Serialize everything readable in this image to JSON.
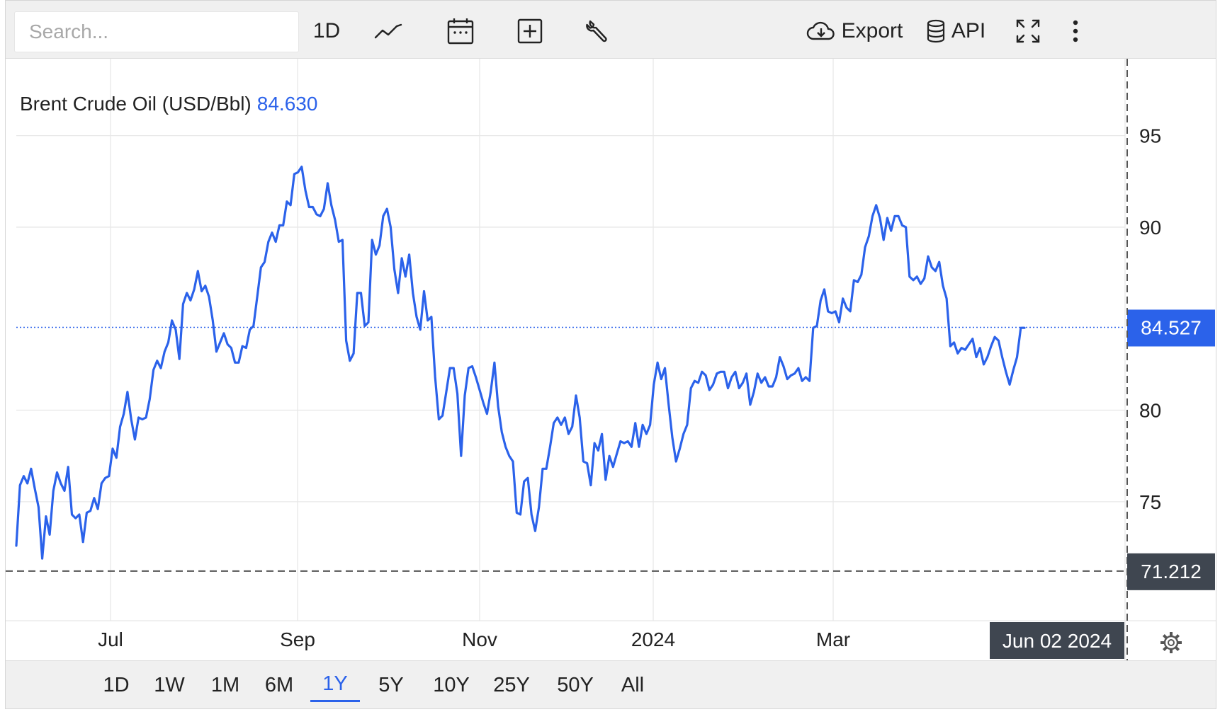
{
  "toolbar": {
    "search_placeholder": "Search...",
    "interval_label": "1D",
    "export_label": "Export",
    "api_label": "API"
  },
  "icons": {
    "chart_type": "line-chart-icon",
    "calendar": "calendar-icon",
    "add": "plus-square-icon",
    "tools": "wrench-icon",
    "export": "cloud-download-icon",
    "api": "database-icon",
    "fullscreen": "expand-icon",
    "more": "vertical-dots-icon",
    "settings": "gear-icon"
  },
  "colors": {
    "line": "#2b62ea",
    "price_badge": "#2b62ea",
    "crosshair_badge": "#3f4650",
    "grid": "#e8e8e8"
  },
  "chart_data": {
    "type": "line",
    "title": "Brent Crude Oil (USD/Bbl)",
    "title_value": "84.630",
    "x_tick_labels": [
      "Jul",
      "Sep",
      "Nov",
      "2024",
      "Mar"
    ],
    "y_tick_labels": [
      "95",
      "90",
      "80",
      "75"
    ],
    "ylim": [
      68.5,
      99.2
    ],
    "grid": true,
    "last_price_label": "84.527",
    "last_price": 84.527,
    "crosshair_price_label": "71.212",
    "crosshair_price": 71.212,
    "crosshair_date_label": "Jun 02 2024",
    "series": [
      {
        "values": [
          72.6,
          75.9,
          76.4,
          76.0,
          76.8,
          75.7,
          74.7,
          71.9,
          74.2,
          73.2,
          75.6,
          76.6,
          76.0,
          75.6,
          76.9,
          74.3,
          74.1,
          74.3,
          72.8,
          74.4,
          74.5,
          75.2,
          74.6,
          76.0,
          76.3,
          76.4,
          77.9,
          77.4,
          79.1,
          79.8,
          81.0,
          79.5,
          78.4,
          79.6,
          79.5,
          79.6,
          80.6,
          82.2,
          82.7,
          82.3,
          83.2,
          83.7,
          84.9,
          84.4,
          82.8,
          85.8,
          86.4,
          86.0,
          86.6,
          87.6,
          86.5,
          86.8,
          86.2,
          84.9,
          83.2,
          83.7,
          84.2,
          83.6,
          83.4,
          82.6,
          82.6,
          83.5,
          83.4,
          84.4,
          84.6,
          86.2,
          87.8,
          88.1,
          89.2,
          89.7,
          89.2,
          90.1,
          90.1,
          91.4,
          91.2,
          92.9,
          93.0,
          93.3,
          92.0,
          91.1,
          91.1,
          90.7,
          90.6,
          91.0,
          92.4,
          91.2,
          90.4,
          89.2,
          89.3,
          83.8,
          82.7,
          83.1,
          86.4,
          86.4,
          84.6,
          84.8,
          89.3,
          88.5,
          89.0,
          90.6,
          91.0,
          90.0,
          87.7,
          86.4,
          88.3,
          87.3,
          88.5,
          86.4,
          85.1,
          84.4,
          86.5,
          84.9,
          85.1,
          81.8,
          79.5,
          79.7,
          81.0,
          82.3,
          82.3,
          80.9,
          77.5,
          80.8,
          82.3,
          82.4,
          81.8,
          81.1,
          80.4,
          79.8,
          81.0,
          82.6,
          80.2,
          78.8,
          78.0,
          77.5,
          77.2,
          74.4,
          74.3,
          76.1,
          76.3,
          74.3,
          73.4,
          74.7,
          76.8,
          76.8,
          78.0,
          79.3,
          79.6,
          79.2,
          79.6,
          78.7,
          79.1,
          80.8,
          79.6,
          77.2,
          77.1,
          75.9,
          78.2,
          77.8,
          78.7,
          76.2,
          77.5,
          76.9,
          77.6,
          78.3,
          78.2,
          78.3,
          78.0,
          79.3,
          78.0,
          79.2,
          78.7,
          79.2,
          81.4,
          82.6,
          81.7,
          82.3,
          80.3,
          78.5,
          77.2,
          77.9,
          78.7,
          79.2,
          81.2,
          81.6,
          81.5,
          82.1,
          81.9,
          81.1,
          81.4,
          82.0,
          82.1,
          82.1,
          81.2,
          81.8,
          82.1,
          81.2,
          81.5,
          82.0,
          80.3,
          81.0,
          82.0,
          81.5,
          81.8,
          81.3,
          81.3,
          81.8,
          82.9,
          82.4,
          81.7,
          81.9,
          82.0,
          82.3,
          81.6,
          81.8,
          81.6,
          84.5,
          84.6,
          86.0,
          86.6,
          85.4,
          85.3,
          85.4,
          84.8,
          86.1,
          85.6,
          85.4,
          87.1,
          87.0,
          87.4,
          88.9,
          89.5,
          90.6,
          91.2,
          90.5,
          89.3,
          90.5,
          89.8,
          90.6,
          90.6,
          90.1,
          90.0,
          87.3,
          87.1,
          87.3,
          86.9,
          87.2,
          88.4,
          87.8,
          87.6,
          88.1,
          86.8,
          86.1,
          83.5,
          83.7,
          83.1,
          83.4,
          83.3,
          83.6,
          83.9,
          82.9,
          83.4,
          82.5,
          82.9,
          83.5,
          84.0,
          83.8,
          82.9,
          82.1,
          81.4,
          82.2,
          82.9,
          84.5,
          84.5
        ]
      }
    ]
  },
  "ranges": [
    {
      "label": "1D",
      "active": false
    },
    {
      "label": "1W",
      "active": false
    },
    {
      "label": "1M",
      "active": false
    },
    {
      "label": "6M",
      "active": false
    },
    {
      "label": "1Y",
      "active": true
    },
    {
      "label": "5Y",
      "active": false
    },
    {
      "label": "10Y",
      "active": false
    },
    {
      "label": "25Y",
      "active": false
    },
    {
      "label": "50Y",
      "active": false
    },
    {
      "label": "All",
      "active": false
    }
  ]
}
